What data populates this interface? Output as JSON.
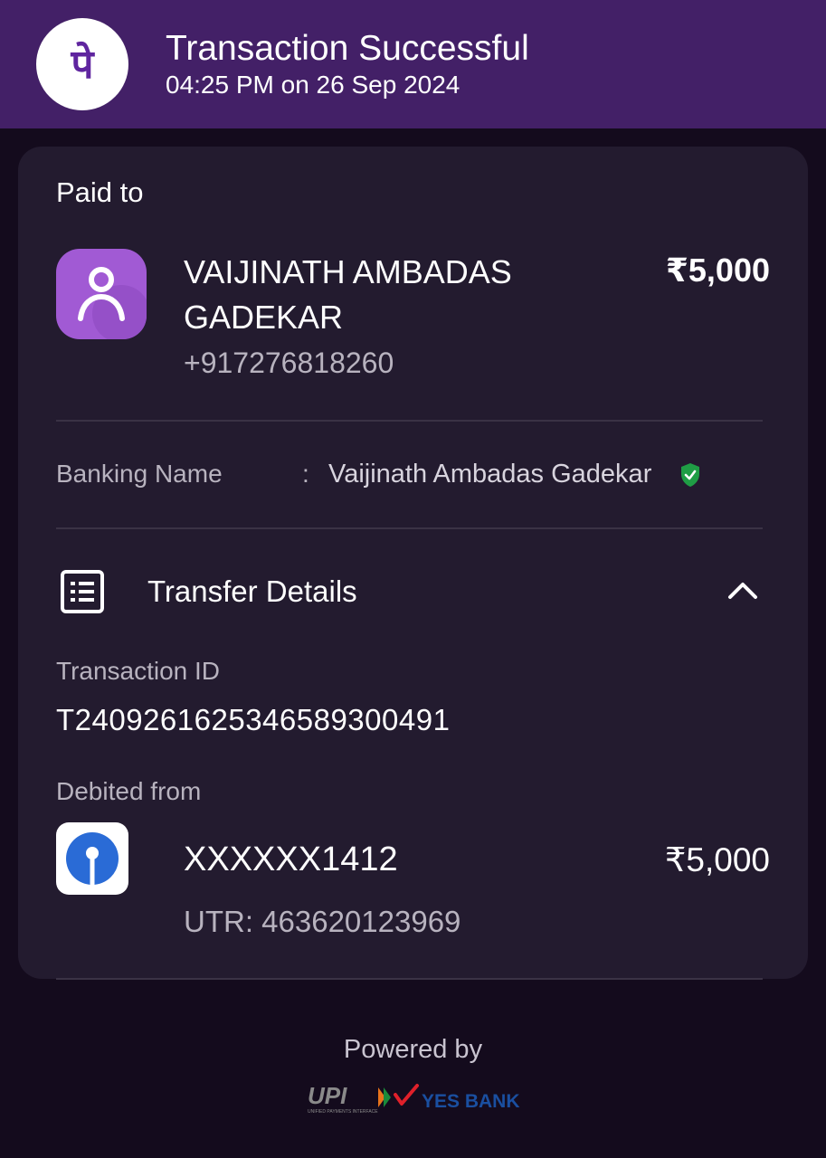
{
  "header": {
    "logo_glyph": "पे",
    "title": "Transaction Successful",
    "subtitle": "04:25 PM on 26 Sep 2024",
    "brand_color": "#432067"
  },
  "payee": {
    "section_label": "Paid to",
    "name": "VAIJINATH AMBADAS GADEKAR",
    "phone": "+917276818260",
    "amount": "₹5,000",
    "avatar_icon": "person-icon"
  },
  "banking": {
    "label": "Banking Name",
    "separator": ":",
    "value": "Vaijinath Ambadas Gadekar",
    "verified_icon": "verified-shield-icon",
    "verified_color": "#1f9d45"
  },
  "transfer": {
    "title": "Transfer Details",
    "icon": "list-document-icon",
    "toggle_icon": "chevron-up-icon",
    "transaction_id_label": "Transaction ID",
    "transaction_id": "T2409261625346589300491",
    "debited_label": "Debited from",
    "bank_icon": "sbi-logo-icon",
    "account": "XXXXXX1412",
    "amount": "₹5,000",
    "utr": "UTR: 463620123969"
  },
  "footer": {
    "powered_by": "Powered by",
    "upi_text": "UPI",
    "upi_tagline": "UNIFIED PAYMENTS INTERFACE",
    "bank_text": "YES BANK"
  }
}
